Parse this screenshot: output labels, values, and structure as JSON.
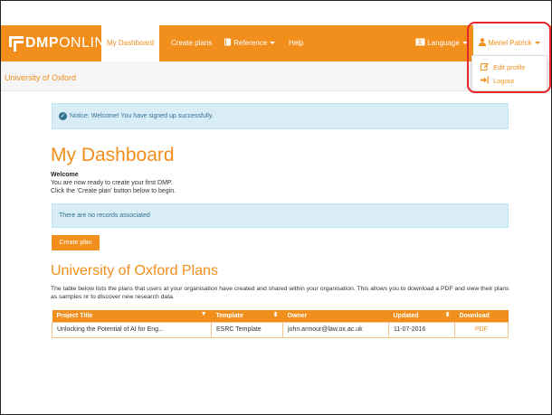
{
  "app": {
    "logo_bold": "DMP",
    "logo_light": "ONLINE"
  },
  "nav": {
    "dashboard": "My Dashboard",
    "create_plans": "Create plans",
    "reference": "Reference",
    "help": "Help",
    "language": "Language",
    "user": "Meriel Patrick"
  },
  "user_menu": {
    "edit_profile": "Edit profile",
    "logout": "Logout"
  },
  "org_name": "University of Oxford",
  "notice": "Notice: Welcome! You have signed up successfully.",
  "dashboard": {
    "title": "My Dashboard",
    "welcome_title": "Welcome",
    "welcome_line1": "You are now ready to create your first DMP.",
    "welcome_line2": "Click the 'Create plan' button below to begin.",
    "no_records": "There are no records associated",
    "create_button": "Create plan"
  },
  "org_plans": {
    "title": "University of Oxford Plans",
    "description": "The table below lists the plans that users at your organisation have created and shared within your organisation. This allows you to download a PDF and view their plans as samples or to discover new research data.",
    "columns": [
      "Project Title",
      "Template",
      "Owner",
      "Updated",
      "Download"
    ],
    "rows": [
      {
        "title": "Unlocking the Potential of AI for Eng...",
        "template": "ESRC Template",
        "owner": "john.armour@law.ox.ac.uk",
        "updated": "11-07-2016",
        "download": "PDF"
      }
    ]
  },
  "colors": {
    "accent": "#f28e1b",
    "info_bg": "#d9edf7",
    "info_text": "#31708f",
    "highlight": "#e8262a"
  },
  "icons": [
    "dmp-logo-icon",
    "book-icon",
    "language-icon",
    "user-icon",
    "edit-icon",
    "logout-icon",
    "check-circle-icon",
    "sort-icon"
  ]
}
